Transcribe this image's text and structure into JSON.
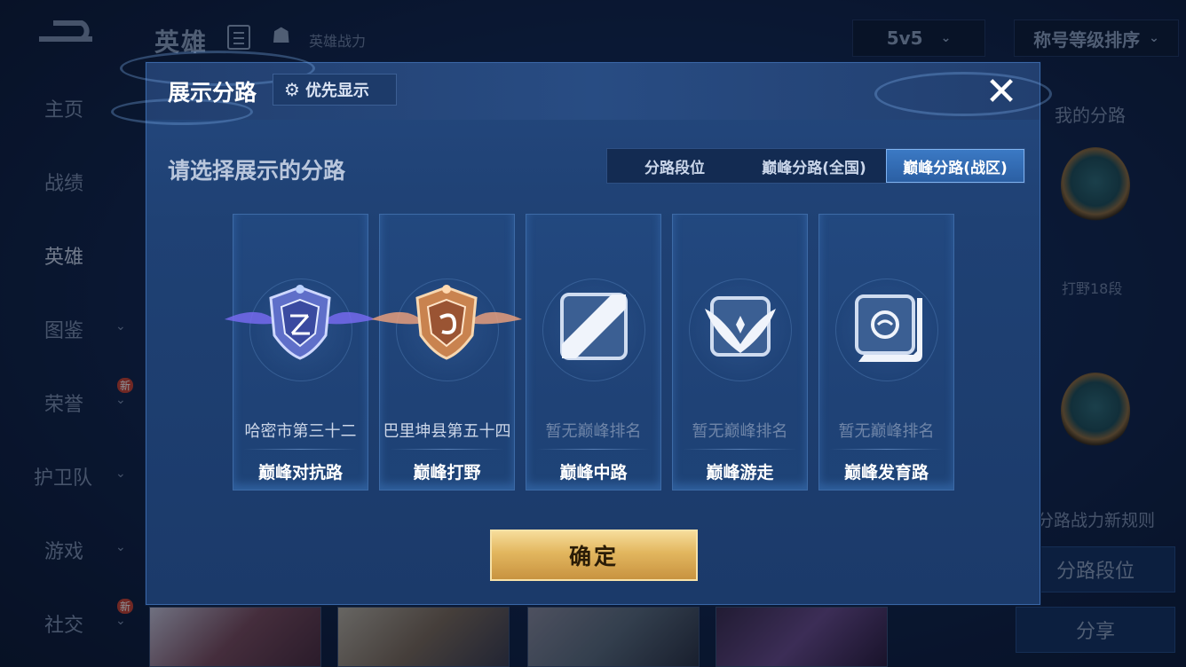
{
  "background": {
    "top_title": "英雄",
    "hero_power_label": "英雄战力",
    "mode_select": "5v5",
    "sort_select": "称号等级排序",
    "sidebar": [
      {
        "label": "主页",
        "chevron": false,
        "new": false
      },
      {
        "label": "战绩",
        "chevron": false,
        "new": false
      },
      {
        "label": "英雄",
        "chevron": false,
        "new": false,
        "active": true
      },
      {
        "label": "图鉴",
        "chevron": true,
        "new": false
      },
      {
        "label": "荣誉",
        "chevron": true,
        "new": true
      },
      {
        "label": "护卫队",
        "chevron": true,
        "new": false
      },
      {
        "label": "游戏",
        "chevron": true,
        "new": false
      },
      {
        "label": "社交",
        "chevron": true,
        "new": true
      }
    ],
    "new_badge": "新",
    "right_panel": {
      "my_lanes": "我的分路",
      "lane_label": "打野18段",
      "rule_text": "分路战力新规则",
      "lane_rank_button": "分路段位",
      "share_button": "分享"
    }
  },
  "dialog": {
    "title": "展示分路",
    "priority_button": "优先显示",
    "prompt": "请选择展示的分路",
    "tabs": [
      "分路段位",
      "巅峰分路(全国)",
      "巅峰分路(战区)"
    ],
    "active_tab": 2,
    "cards": [
      {
        "rank": "哈密市第三十二",
        "lane": "巅峰对抗路",
        "has_rank": true
      },
      {
        "rank": "巴里坤县第五十四",
        "lane": "巅峰打野",
        "has_rank": true
      },
      {
        "rank": "暂无巅峰排名",
        "lane": "巅峰中路",
        "has_rank": false
      },
      {
        "rank": "暂无巅峰排名",
        "lane": "巅峰游走",
        "has_rank": false
      },
      {
        "rank": "暂无巅峰排名",
        "lane": "巅峰发育路",
        "has_rank": false
      }
    ],
    "confirm_button": "确定"
  },
  "colors": {
    "dialog_bg": "#1f4174",
    "tab_active": "#3b79c4",
    "confirm_gold": "#e2b65e"
  }
}
